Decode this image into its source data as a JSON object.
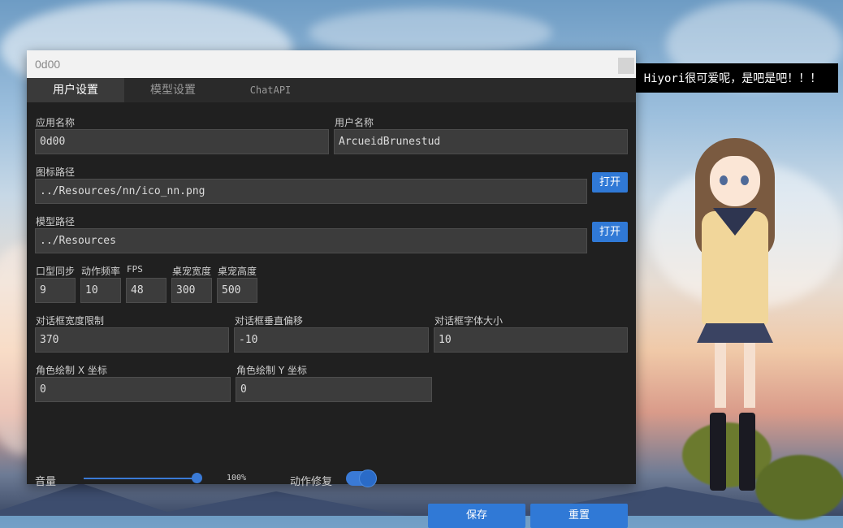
{
  "window": {
    "title": "0d00"
  },
  "speech_bubble": "Hiyori很可爱呢，是吧是吧！！！",
  "tabs": [
    "用户设置",
    "模型设置",
    "ChatAPI"
  ],
  "fields": {
    "app_name": {
      "label": "应用名称",
      "value": "0d00"
    },
    "user_name": {
      "label": "用户名称",
      "value": "ArcueidBrunestud"
    },
    "icon_path": {
      "label": "图标路径",
      "value": "../Resources/nn/ico_nn.png",
      "button": "打开"
    },
    "model_path": {
      "label": "模型路径",
      "value": "../Resources",
      "button": "打开"
    },
    "lip_sync": {
      "label": "口型同步",
      "value": "9"
    },
    "motion_freq": {
      "label": "动作频率",
      "value": "10"
    },
    "fps": {
      "label": "FPS",
      "value": "48"
    },
    "pet_width": {
      "label": "桌宠宽度",
      "value": "300"
    },
    "pet_height": {
      "label": "桌宠高度",
      "value": "500"
    },
    "dialog_width_limit": {
      "label": "对话框宽度限制",
      "value": "370"
    },
    "dialog_v_offset": {
      "label": "对话框垂直偏移",
      "value": "-10"
    },
    "dialog_font_size": {
      "label": "对话框字体大小",
      "value": "10"
    },
    "draw_x": {
      "label": "角色绘制 X 坐标",
      "value": "0"
    },
    "draw_y": {
      "label": "角色绘制 Y 坐标",
      "value": "0"
    }
  },
  "volume": {
    "label": "音量",
    "value_text": "100%",
    "level": 1.0
  },
  "motion_fix": {
    "label": "动作修复",
    "on": true
  },
  "actions": {
    "save": "保存",
    "reset": "重置"
  },
  "colors": {
    "accent": "#3079d6",
    "panel": "#202020",
    "input": "#3c3c3c"
  }
}
